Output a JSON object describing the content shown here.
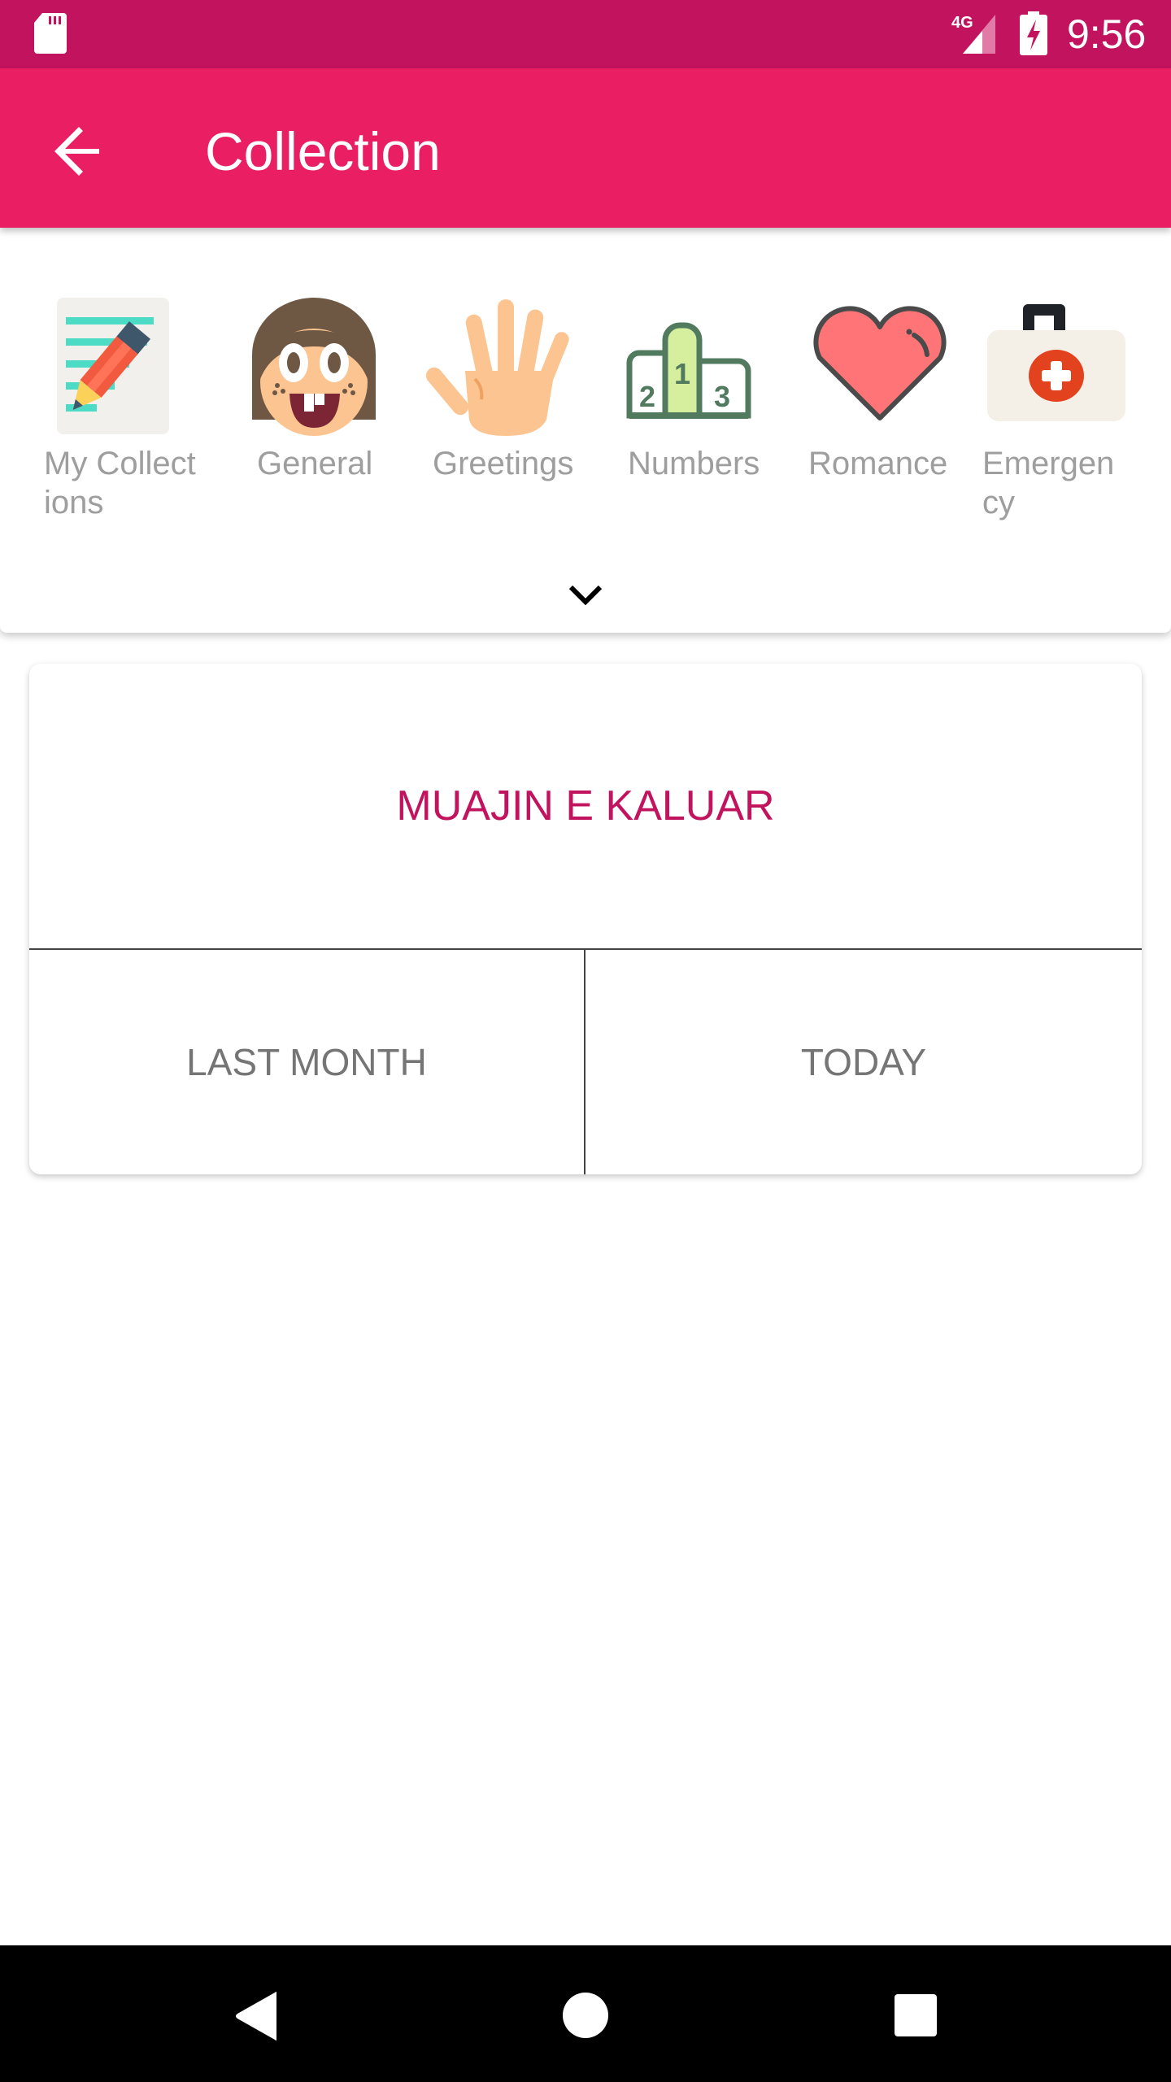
{
  "status_bar": {
    "time": "9:56",
    "network": "4G",
    "icons": [
      "sd-card-icon",
      "signal-4g-icon",
      "battery-charging-icon"
    ]
  },
  "app_bar": {
    "title": "Collection",
    "back_icon": "arrow-back-icon"
  },
  "categories": [
    {
      "label": "My Collect\nions",
      "icon": "notepad-pencil-icon"
    },
    {
      "label": "General",
      "icon": "smiling-face-icon"
    },
    {
      "label": "Greetings",
      "icon": "waving-hand-icon"
    },
    {
      "label": "Numbers",
      "icon": "podium-icon"
    },
    {
      "label": "Romance",
      "icon": "heart-icon"
    },
    {
      "label": "Emergen\ncy",
      "icon": "first-aid-kit-icon"
    }
  ],
  "expand_icon": "chevron-down-icon",
  "card": {
    "title": "MUAJIN E KALUAR",
    "left_button": "LAST MONTH",
    "right_button": "TODAY"
  },
  "nav_bar": {
    "back": "nav-back-icon",
    "home": "nav-home-icon",
    "recents": "nav-recents-icon"
  },
  "colors": {
    "status_bar": "#c2135e",
    "app_bar": "#e91e63",
    "card_title": "#c2135e",
    "label_gray": "#9e9e9e"
  }
}
